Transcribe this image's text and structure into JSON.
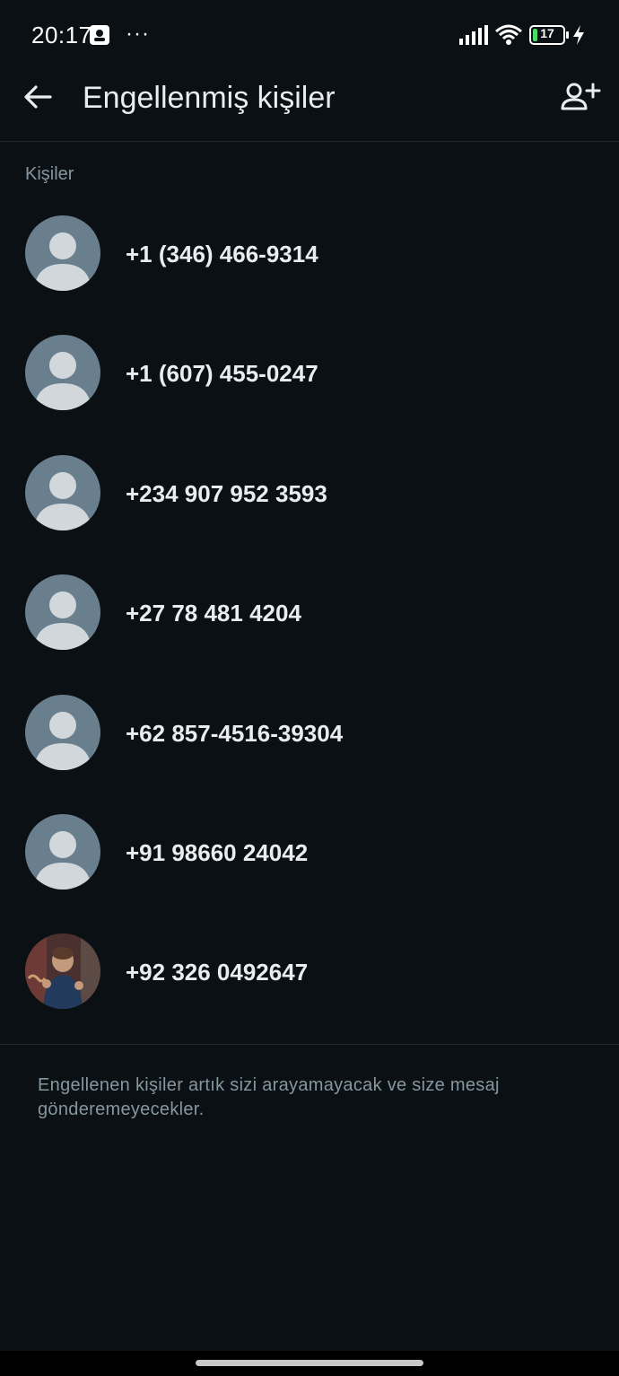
{
  "status_bar": {
    "time": "20:17",
    "more": "···",
    "battery_level": "17",
    "battery_fraction": 0.17,
    "icons": [
      "notification-icon",
      "signal-icon",
      "wifi-icon",
      "battery-icon",
      "charging-icon"
    ]
  },
  "app_bar": {
    "title": "Engellenmiş kişiler",
    "back_icon": "arrow-left-icon",
    "add_icon": "add-contact-icon"
  },
  "section": {
    "label": "Kişiler"
  },
  "contacts": [
    {
      "number": "+1 (346) 466-9314",
      "avatar": "default-avatar-icon"
    },
    {
      "number": "+1 (607) 455-0247",
      "avatar": "default-avatar-icon"
    },
    {
      "number": "+234 907 952 3593",
      "avatar": "default-avatar-icon"
    },
    {
      "number": "+27 78 481 4204",
      "avatar": "default-avatar-icon"
    },
    {
      "number": "+62 857-4516-39304",
      "avatar": "default-avatar-icon"
    },
    {
      "number": "+91 98660 24042",
      "avatar": "default-avatar-icon"
    },
    {
      "number": "+92 326 0492647",
      "avatar": "photo-avatar"
    }
  ],
  "footer": {
    "note": "Engellenen kişiler artık sizi arayamayacak ve size mesaj gönderemeyecekler."
  },
  "colors": {
    "background": "#0b1014",
    "text_primary": "#e9edef",
    "text_secondary": "#8696a0",
    "avatar_bg": "#6a7f8e",
    "avatar_fg": "#d1d7db",
    "battery_accent": "#4cd964"
  }
}
